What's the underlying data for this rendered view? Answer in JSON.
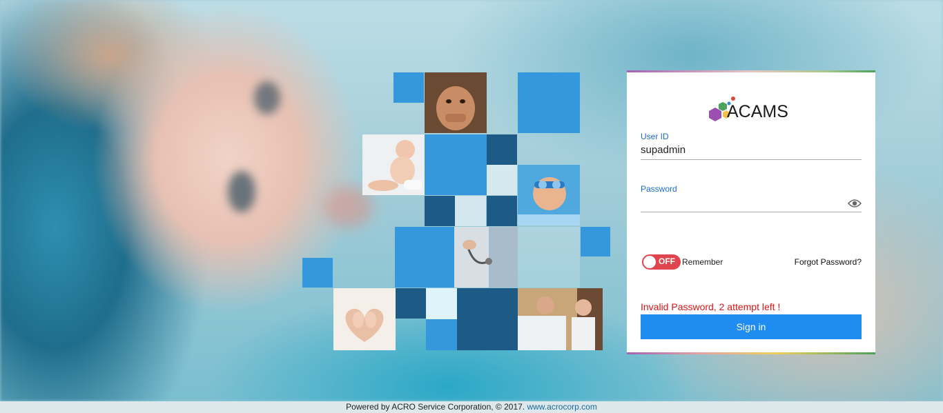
{
  "login": {
    "logo_text": "ACAMS",
    "user_id_label": "User ID",
    "user_id_value": "supadmin",
    "password_label": "Password",
    "password_value": "",
    "toggle_text": "OFF",
    "remember_label": "Remember",
    "forgot_label": "Forgot Password?",
    "error_message": "Invalid Password, 2 attempt left !",
    "signin_label": "Sign in"
  },
  "footer": {
    "text": "Powered by ACRO Service Corporation, © 2017.",
    "link_text": "www.acrocorp.com"
  },
  "colors": {
    "accent": "#1e8cf0",
    "error": "#e01414",
    "toggle_off": "#e0444d",
    "tile_blue": "#3598dc",
    "tile_dark": "#1d5a86"
  },
  "icons": {
    "password_toggle": "eye-icon",
    "logo": "hexagon-logo-icon"
  }
}
